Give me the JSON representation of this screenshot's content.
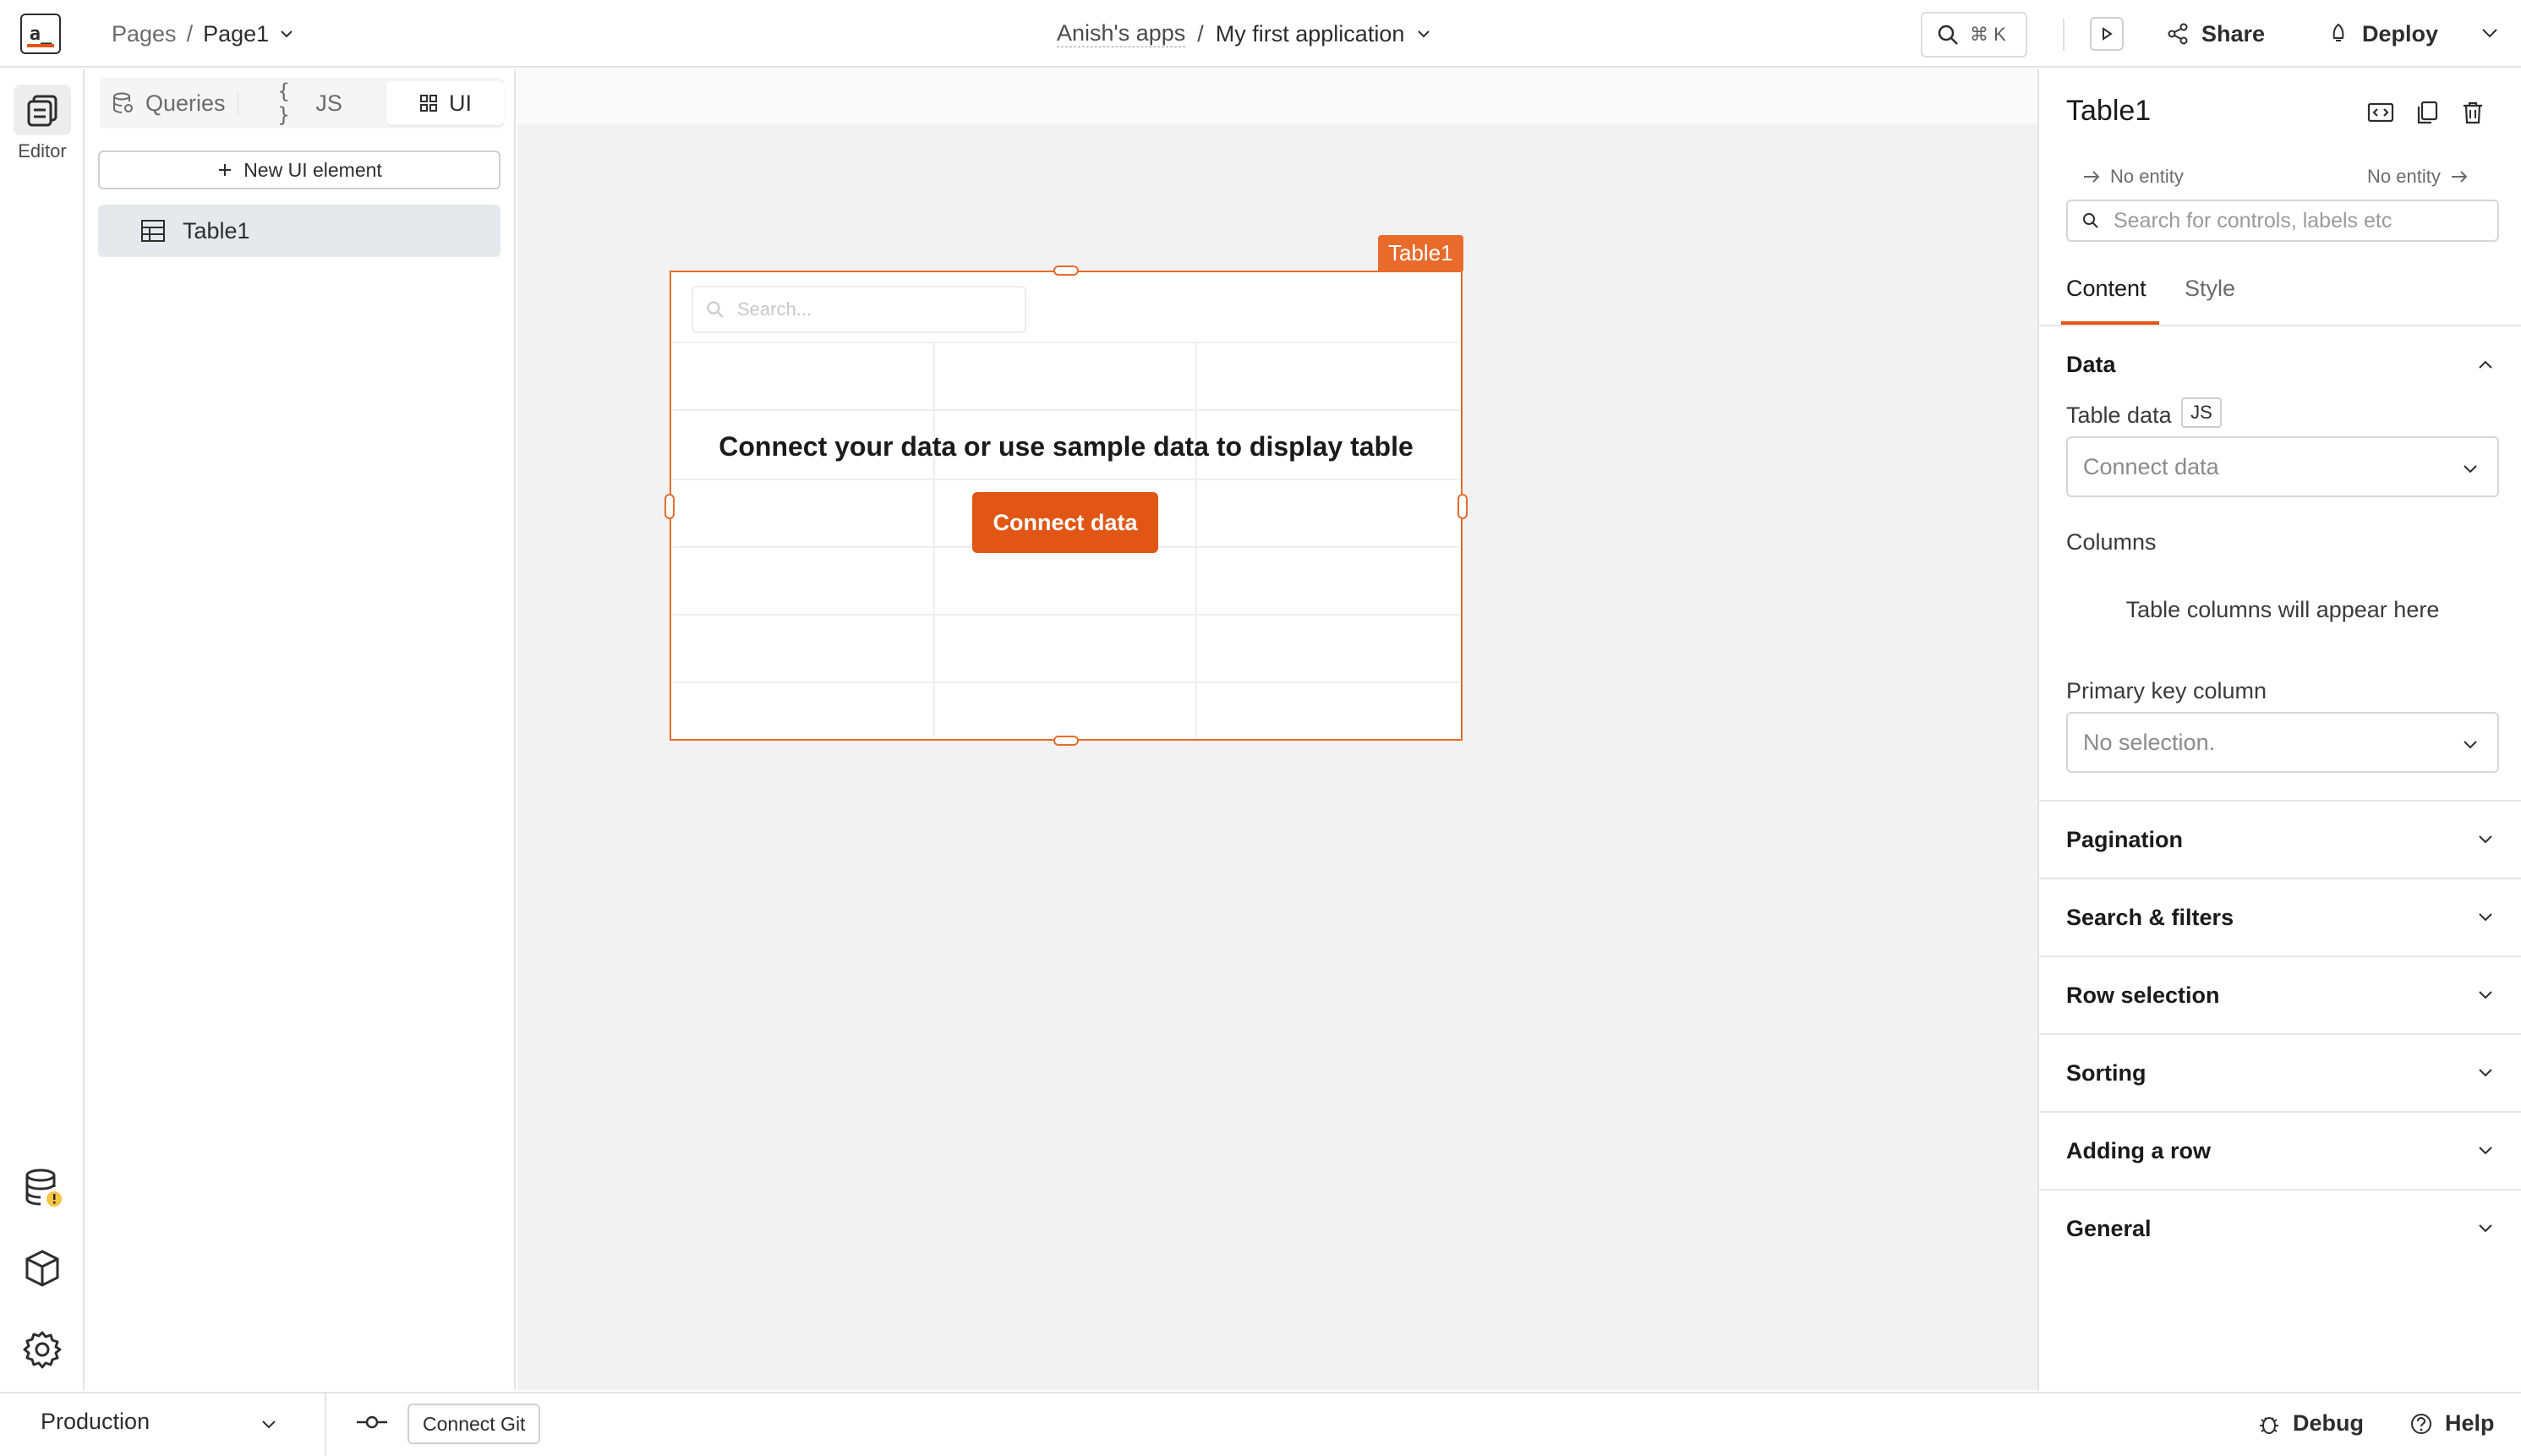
{
  "logo": "a_",
  "breadcrumb": {
    "pages": "Pages",
    "sep": "/",
    "current": "Page1"
  },
  "header": {
    "workspace": "Anish's apps",
    "sep": "/",
    "app_name": "My first application"
  },
  "search": {
    "shortcut": "⌘ K"
  },
  "actions": {
    "share": "Share",
    "deploy": "Deploy"
  },
  "rail": {
    "editor_label": "Editor"
  },
  "explorer": {
    "tabs": [
      {
        "label": "Queries"
      },
      {
        "label": "JS"
      },
      {
        "label": "UI"
      }
    ],
    "new_ui_label": "New UI element",
    "entities": [
      {
        "label": "Table1"
      }
    ]
  },
  "widget": {
    "label": "Table1",
    "search_placeholder": "Search...",
    "empty_message": "Connect your data or use sample data to display table",
    "connect_label": "Connect data"
  },
  "pane": {
    "title": "Table1",
    "no_entity_left": "No entity",
    "no_entity_right": "No entity",
    "search_placeholder": "Search for controls, labels etc",
    "tabs": {
      "content": "Content",
      "style": "Style"
    },
    "data_section": "Data",
    "table_data_label": "Table data",
    "js_badge": "JS",
    "table_data_placeholder": "Connect data",
    "columns_label": "Columns",
    "columns_empty": "Table columns will appear here",
    "primary_key_label": "Primary key column",
    "primary_key_placeholder": "No selection.",
    "sections": [
      "Pagination",
      "Search & filters",
      "Row selection",
      "Sorting",
      "Adding a row",
      "General"
    ]
  },
  "bottom": {
    "environment": "Production",
    "connect_git": "Connect Git",
    "debug": "Debug",
    "help": "Help"
  },
  "colors": {
    "accent": "#e15615",
    "selection": "#e86b2c"
  }
}
